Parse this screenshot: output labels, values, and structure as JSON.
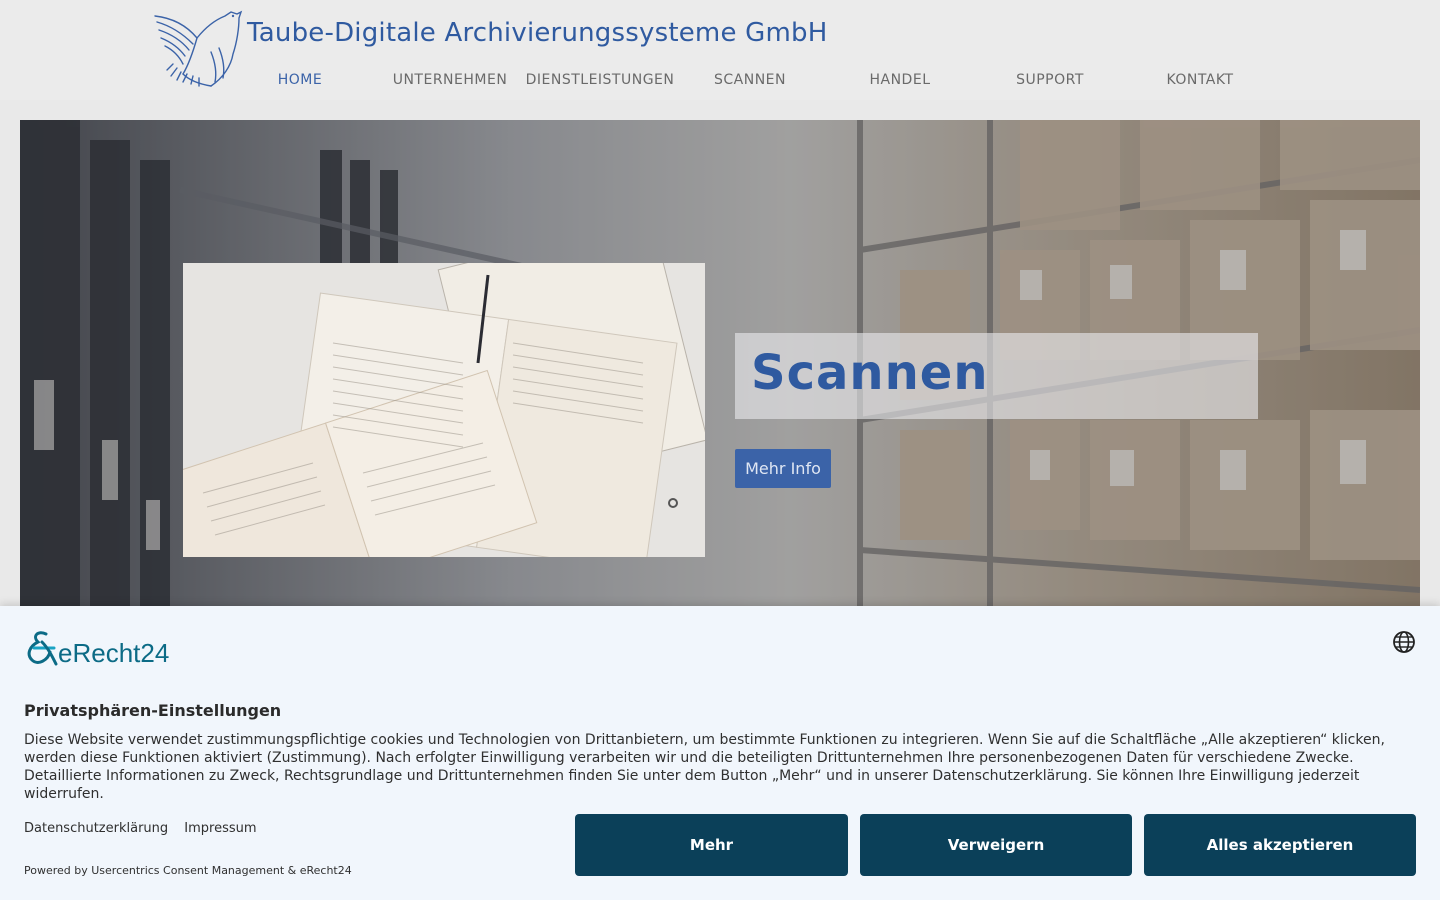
{
  "header": {
    "site_title": "Taube-Digitale Archivierungssysteme GmbH",
    "logo_icon": "dove-logo-icon",
    "brand_color": "#2f5aa0"
  },
  "nav": {
    "items": [
      {
        "label": "HOME",
        "active": true
      },
      {
        "label": "UNTERNEHMEN"
      },
      {
        "label": "DIENSTLEISTUNGEN"
      },
      {
        "label": "SCANNEN"
      },
      {
        "label": "HANDEL"
      },
      {
        "label": "SUPPORT"
      },
      {
        "label": "KONTAKT"
      }
    ]
  },
  "hero": {
    "title": "Scannen",
    "button_label": "Mehr Info",
    "background": "archive-shelves-photo",
    "image": "open-books-photo"
  },
  "consent": {
    "logo_text": "eRecht24",
    "heading": "Privatsphären-Einstellungen",
    "body": "Diese Website verwendet zustimmungspflichtige cookies und Technologien von Drittanbietern, um bestimmte Funktionen zu integrieren. Wenn Sie auf die Schaltfläche „Alle akzeptieren“ klicken, werden diese Funktionen aktiviert (Zustimmung). Nach erfolgter Einwilligung verarbeiten wir und die beteiligten Drittunternehmen Ihre personenbezogenen Daten für verschiedene Zwecke. Detaillierte Informationen zu Zweck, Rechtsgrundlage und Drittunternehmen finden Sie unter dem Button „Mehr“ und in unserer Datenschutzerklärung. Sie können Ihre Einwilligung jederzeit widerrufen.",
    "links": {
      "privacy": "Datenschutzerklärung",
      "imprint": "Impressum"
    },
    "powered_by": "Powered by Usercentrics Consent Management & eRecht24",
    "buttons": {
      "more": "Mehr",
      "deny": "Verweigern",
      "accept_all": "Alles akzeptieren"
    },
    "button_color": "#0b4059",
    "language_icon": "globe-icon"
  }
}
